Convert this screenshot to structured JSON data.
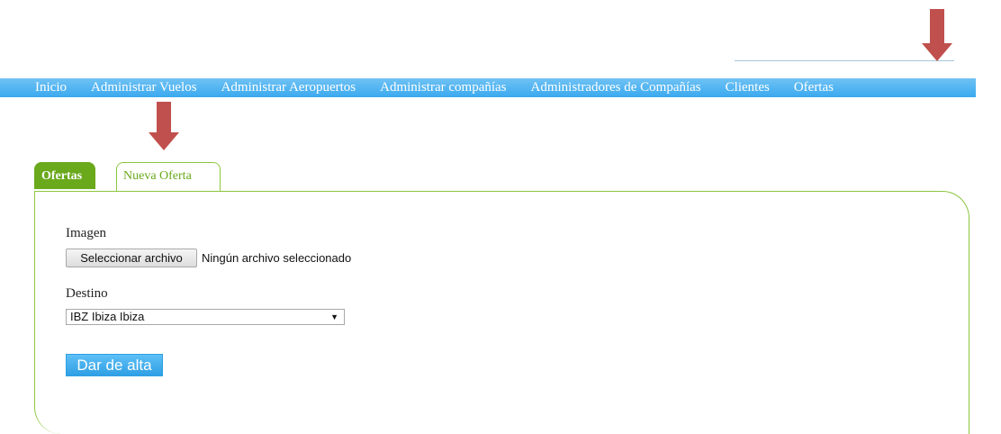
{
  "nav": {
    "items": [
      {
        "label": "Inicio"
      },
      {
        "label": "Administrar Vuelos"
      },
      {
        "label": "Administrar Aeropuertos"
      },
      {
        "label": "Administrar compañías"
      },
      {
        "label": "Administradores de Compañías"
      },
      {
        "label": "Clientes"
      },
      {
        "label": "Ofertas"
      }
    ]
  },
  "tabs": {
    "active": "Ofertas",
    "inactive": "Nueva Oferta"
  },
  "form": {
    "image_label": "Imagen",
    "file_button": "Seleccionar archivo",
    "file_status": "Ningún archivo seleccionado",
    "destination_label": "Destino",
    "destination_selected": "IBZ Ibiza Ibiza",
    "submit_label": "Dar de alta"
  },
  "icons": {
    "dropdown_caret": "▼"
  },
  "colors": {
    "nav_bg": "#3aa9ef",
    "tab_green": "#6aa91c",
    "panel_border": "#8cc63f",
    "annotation_arrow": "#c0504d",
    "submit_bg": "#2f9fe4"
  }
}
